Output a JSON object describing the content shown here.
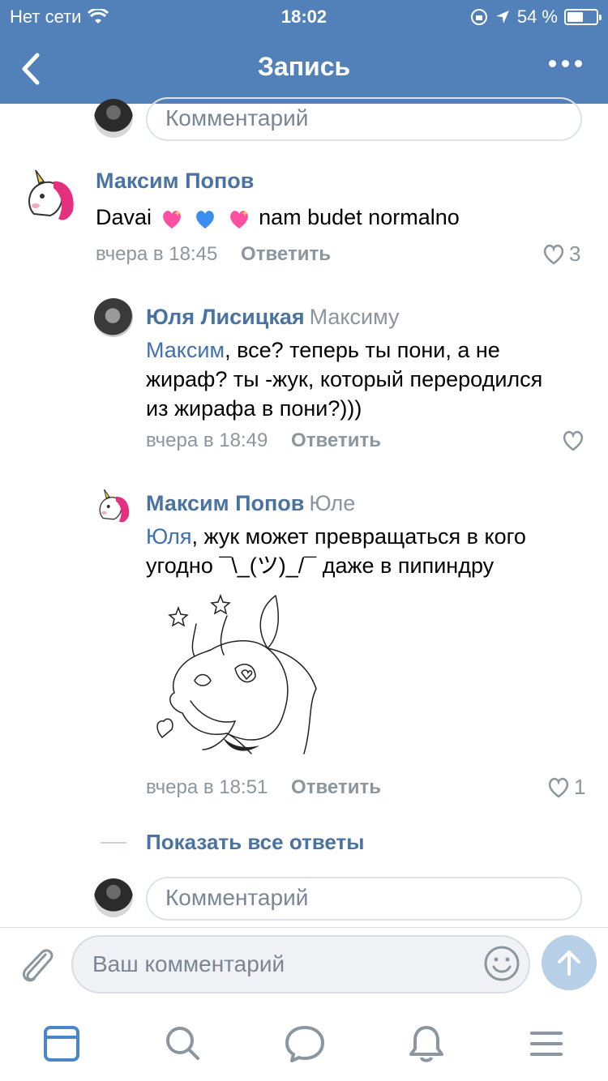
{
  "status": {
    "carrier": "Нет сети",
    "time": "18:02",
    "battery": "54 %"
  },
  "nav": {
    "title": "Запись"
  },
  "top_comment": {
    "placeholder": "Комментарий"
  },
  "comments": [
    {
      "author": "Максим Попов",
      "text_before": "Davai",
      "text_after": "nam budet normalno",
      "time": "вчера в 18:45",
      "reply": "Ответить",
      "likes": "3"
    },
    {
      "author": "Юля Лисицкая",
      "to": "Максиму",
      "mention": "Максим",
      "text_line1": ", все? теперь ты пони, а не",
      "text_line2": "жираф? ты -жук, который переродился",
      "text_line3": "из жирафа в пони?)))",
      "time": "вчера в 18:49",
      "reply": "Ответить"
    },
    {
      "author": "Максим Попов",
      "to": "Юле",
      "mention": "Юля",
      "text_line1": ", жук может превращаться в кого",
      "text_line2": "угодно ¯\\_(ツ)_/¯ даже в пипиндру",
      "time": "вчера в 18:51",
      "reply": "Ответить",
      "likes": "1"
    }
  ],
  "show_all": "Показать все ответы",
  "bottom_comment": {
    "placeholder": "Комментарий"
  },
  "composer": {
    "placeholder": "Ваш комментарий"
  }
}
